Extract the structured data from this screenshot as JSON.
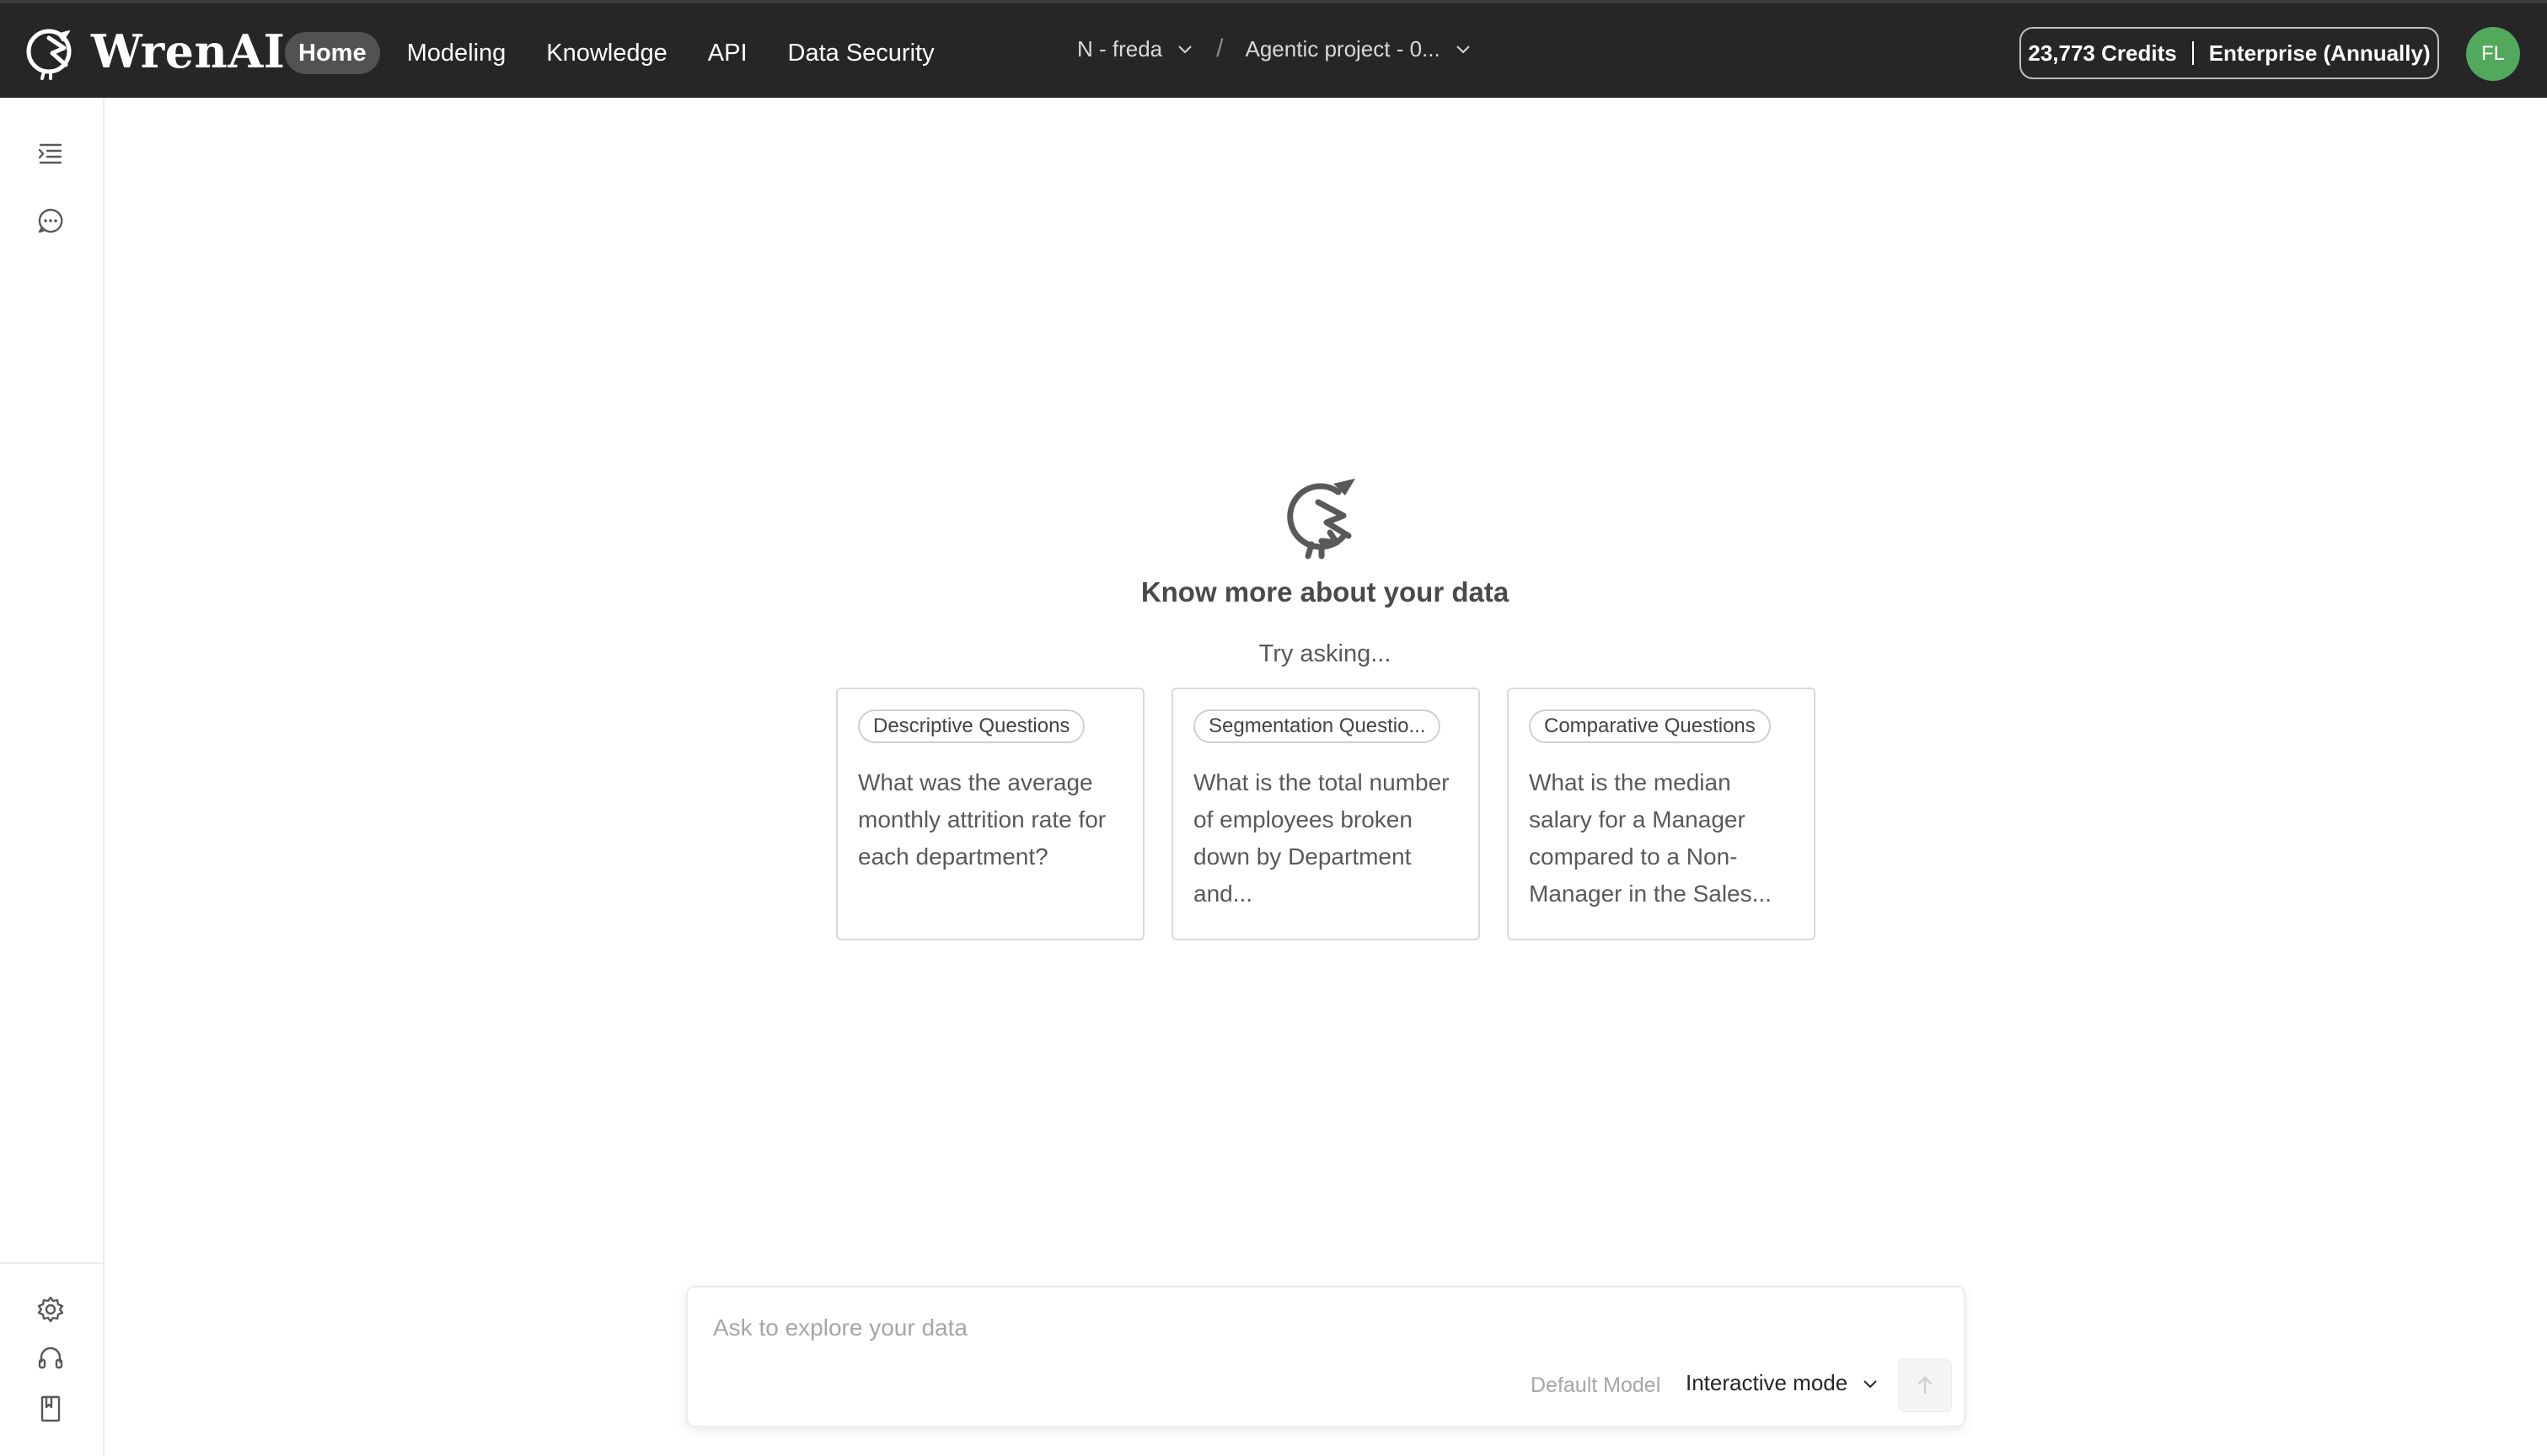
{
  "brand": {
    "name": "WrenAI"
  },
  "nav": {
    "links": [
      "Home",
      "Modeling",
      "Knowledge",
      "API",
      "Data Security"
    ],
    "active": "Home"
  },
  "breadcrumb": {
    "workspace": "N - freda",
    "separator": "/",
    "project": "Agentic project - 0..."
  },
  "account": {
    "credits": "23,773 Credits",
    "plan": "Enterprise (Annually)",
    "avatar_initials": "FL"
  },
  "sidebar": {
    "top_icons": [
      "indent-list-icon",
      "chat-bubble-icon"
    ],
    "bottom_icons": [
      "gear-icon",
      "headset-icon",
      "book-icon"
    ]
  },
  "main": {
    "title": "Know more about your data",
    "subtitle": "Try asking...",
    "cards": [
      {
        "tag": "Descriptive Questions",
        "text": "What was the average monthly attrition rate for each department?"
      },
      {
        "tag": "Segmentation Questio...",
        "text": "What is the total number of employees broken down by Department and..."
      },
      {
        "tag": "Comparative Questions",
        "text": "What is the median salary for a Manager compared to a Non-Manager in the Sales..."
      }
    ]
  },
  "ask": {
    "placeholder": "Ask to explore your data",
    "default_model_label": "Default Model",
    "mode": "Interactive mode"
  },
  "colors": {
    "navbar_bg": "#262626",
    "active_tab_bg": "#525252",
    "avatar_bg": "#52a95d"
  }
}
